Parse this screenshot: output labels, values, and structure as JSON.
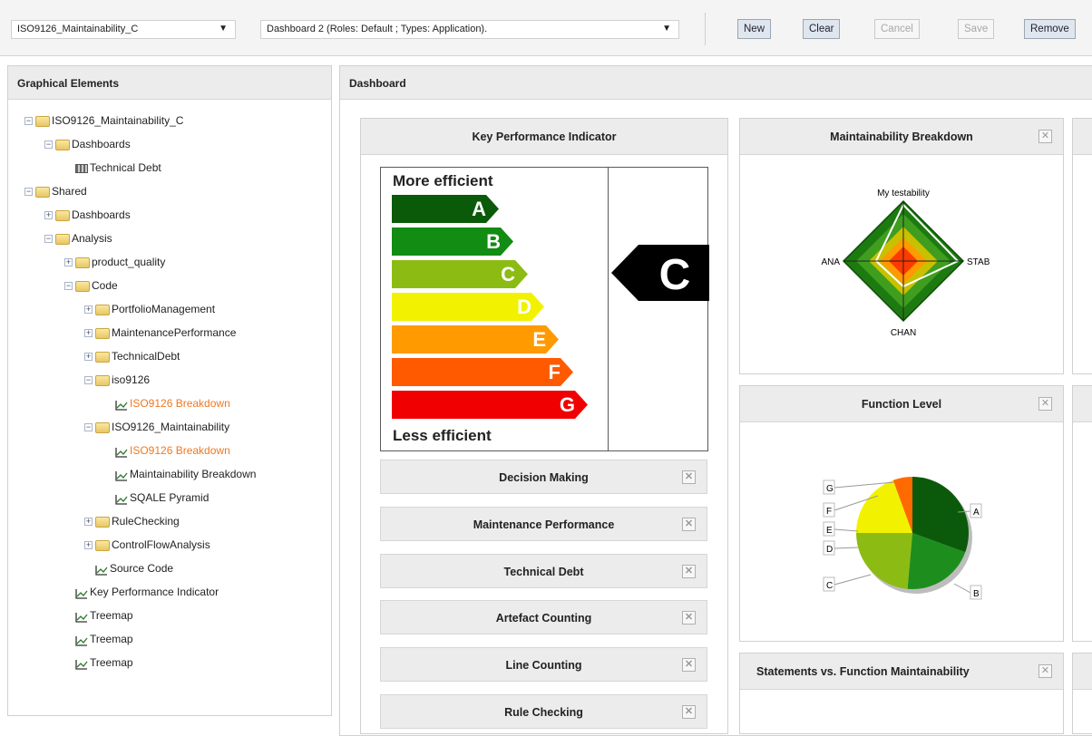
{
  "toolbar": {
    "model_select": "ISO9126_Maintainability_C",
    "dashboard_select": "Dashboard 2 (Roles: Default ; Types: Application).",
    "buttons": [
      "New",
      "Clear",
      "Cancel",
      "Save",
      "Remove"
    ]
  },
  "left_panel": {
    "title": "Graphical Elements",
    "tree": [
      {
        "label": "ISO9126_Maintainability_C",
        "icon": "folder",
        "exp": "−"
      },
      {
        "label": "Dashboards",
        "icon": "folder",
        "exp": "−"
      },
      {
        "label": "Technical Debt",
        "icon": "grid"
      },
      {
        "label": "Shared",
        "icon": "folder",
        "exp": "−"
      },
      {
        "label": "Dashboards",
        "icon": "folder",
        "exp": "+"
      },
      {
        "label": "Analysis",
        "icon": "folder",
        "exp": "−"
      },
      {
        "label": "product_quality",
        "icon": "folder",
        "exp": "+"
      },
      {
        "label": "Code",
        "icon": "folder",
        "exp": "−"
      },
      {
        "label": "PortfolioManagement",
        "icon": "folder",
        "exp": "+"
      },
      {
        "label": "MaintenancePerformance",
        "icon": "folder",
        "exp": "+"
      },
      {
        "label": "TechnicalDebt",
        "icon": "folder",
        "exp": "+"
      },
      {
        "label": "iso9126",
        "icon": "folder",
        "exp": "−"
      },
      {
        "label": "ISO9126 Breakdown",
        "icon": "chart",
        "highlight": true
      },
      {
        "label": "ISO9126_Maintainability",
        "icon": "folder",
        "exp": "−"
      },
      {
        "label": "ISO9126 Breakdown",
        "icon": "chart",
        "highlight": true
      },
      {
        "label": "Maintainability Breakdown",
        "icon": "chart"
      },
      {
        "label": "SQALE Pyramid",
        "icon": "chart"
      },
      {
        "label": "RuleChecking",
        "icon": "folder",
        "exp": "+"
      },
      {
        "label": "ControlFlowAnalysis",
        "icon": "folder",
        "exp": "+"
      },
      {
        "label": "Source Code",
        "icon": "chart"
      },
      {
        "label": "Key Performance Indicator",
        "icon": "chart"
      },
      {
        "label": "Treemap",
        "icon": "chart"
      },
      {
        "label": "Treemap",
        "icon": "chart"
      },
      {
        "label": "Treemap",
        "icon": "chart"
      }
    ]
  },
  "main_panel": {
    "title": "Dashboard",
    "kpi": {
      "title": "Key Performance Indicator",
      "top_label": "More efficient",
      "bottom_label": "Less efficient",
      "grades": [
        "A",
        "B",
        "C",
        "D",
        "E",
        "F",
        "G"
      ],
      "grade_colors": [
        "#0a5a0a",
        "#128c12",
        "#8cbc14",
        "#f2f200",
        "#ff9a00",
        "#ff5a00",
        "#f00000"
      ],
      "current_grade": "C"
    },
    "collapsed_widgets": [
      "Decision Making",
      "Maintenance Performance",
      "Technical Debt",
      "Artefact Counting",
      "Line Counting",
      "Rule Checking"
    ],
    "radar": {
      "title": "Maintainability Breakdown",
      "axes": [
        "My testability",
        "STAB",
        "CHAN",
        "ANA"
      ]
    },
    "function_level": {
      "title": "Function Level",
      "slices": [
        "A",
        "B",
        "C",
        "D",
        "E",
        "F",
        "G"
      ]
    },
    "statements": {
      "title": "Statements vs. Function Maintainability"
    },
    "close_glyph": "✕"
  }
}
